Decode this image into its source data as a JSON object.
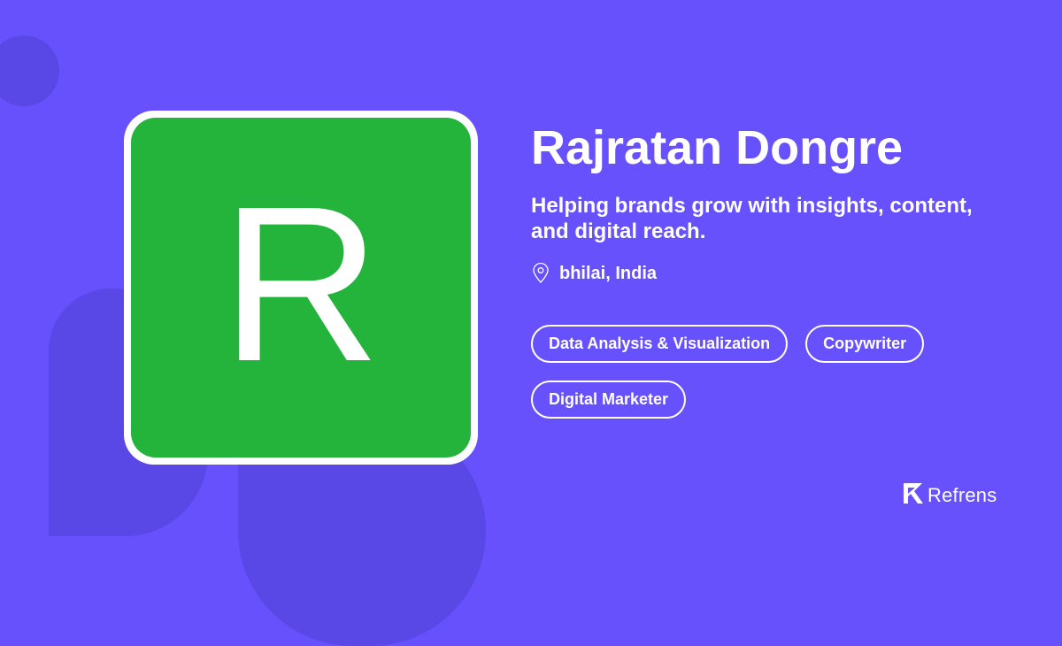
{
  "profile": {
    "avatar_letter": "R",
    "avatar_color": "#24b33b",
    "name": "Rajratan Dongre",
    "tagline": "Helping brands grow with insights, content, and digital reach.",
    "location": "bhilai, India",
    "location_icon": "location-pin-icon"
  },
  "tags": [
    "Data Analysis & Visualization",
    "Copywriter",
    "Digital Marketer"
  ],
  "brand": {
    "name": "Refrens",
    "logo_icon": "refrens-logo-icon"
  },
  "colors": {
    "background": "#6651fd",
    "decoration": "#5a48e6",
    "text": "#ffffff"
  }
}
